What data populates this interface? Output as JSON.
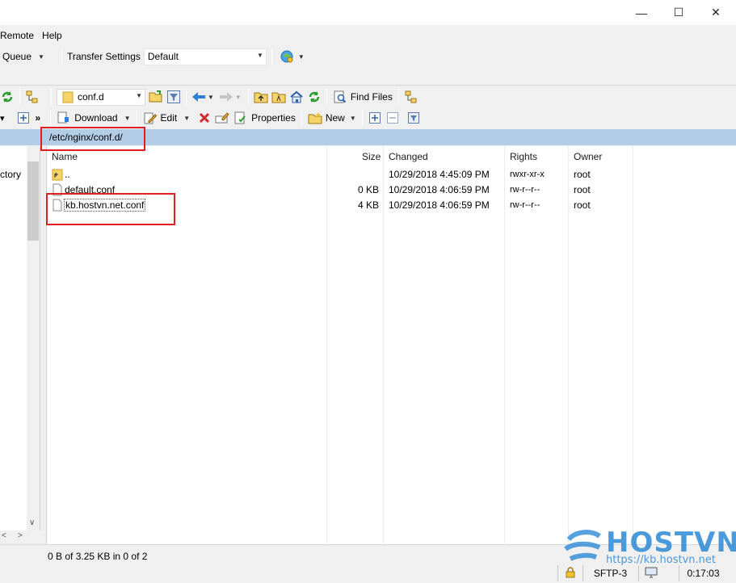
{
  "window": {
    "minimize": "—",
    "maximize": "☐",
    "close": "✕"
  },
  "menu": {
    "remote": "Remote",
    "help": "Help"
  },
  "toolbar1": {
    "queue": "Queue",
    "transfer_settings_label": "Transfer Settings",
    "transfer_settings_value": "Default"
  },
  "toolbar2": {
    "dir_combo": "conf.d",
    "find_files": "Find Files"
  },
  "toolbar3": {
    "download": "Download",
    "edit": "Edit",
    "properties": "Properties",
    "new": "New"
  },
  "path": "/etc/nginx/conf.d/",
  "left_pane": {
    "partial_label": "ctory"
  },
  "columns": {
    "name": "Name",
    "size": "Size",
    "changed": "Changed",
    "rights": "Rights",
    "owner": "Owner"
  },
  "files": [
    {
      "name": "..",
      "size": "",
      "changed": "10/29/2018 4:45:09 PM",
      "rights": "rwxr-xr-x",
      "owner": "root",
      "type": "parent"
    },
    {
      "name": "default.conf",
      "size": "0 KB",
      "changed": "10/29/2018 4:06:59 PM",
      "rights": "rw-r--r--",
      "owner": "root",
      "type": "file"
    },
    {
      "name": "kb.hostvn.net.conf",
      "size": "4 KB",
      "changed": "10/29/2018 4:06:59 PM",
      "rights": "rw-r--r--",
      "owner": "root",
      "type": "file"
    }
  ],
  "status": {
    "summary": "0 B of 3.25 KB in 0 of 2",
    "protocol": "SFTP-3",
    "elapsed": "0:17:03"
  },
  "watermark": {
    "brand": "HOSTVN",
    "url": "https://kb.hostvn.net"
  },
  "colors": {
    "path_bar": "#b4cde6",
    "highlight": "#e02020",
    "brand": "#2c8ad6"
  }
}
